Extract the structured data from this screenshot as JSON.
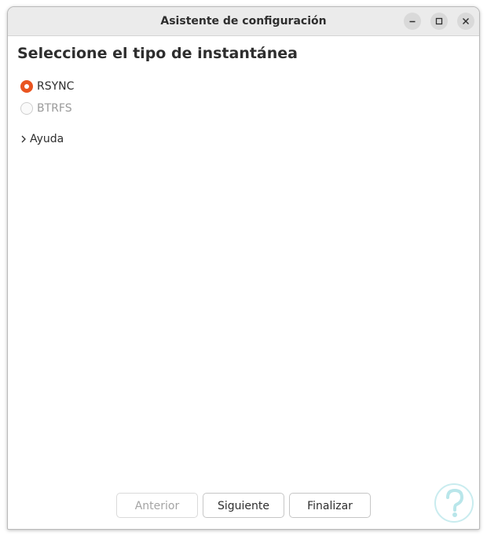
{
  "window": {
    "title": "Asistente de configuración",
    "controls": [
      "minimize-icon",
      "maximize-icon",
      "close-icon"
    ]
  },
  "page": {
    "heading": "Seleccione el tipo de instantánea"
  },
  "options": [
    {
      "label": "RSYNC",
      "selected": true,
      "enabled": true
    },
    {
      "label": "BTRFS",
      "selected": false,
      "enabled": false
    }
  ],
  "help": {
    "label": "Ayuda",
    "icon": "chevron-right-icon"
  },
  "buttons": {
    "previous": {
      "label": "Anterior",
      "enabled": false
    },
    "next": {
      "label": "Siguiente",
      "enabled": true
    },
    "finish": {
      "label": "Finalizar",
      "enabled": true
    }
  },
  "colors": {
    "accent": "#e95420",
    "titlebar": "#ebebeb",
    "watermark": "#b9e6ea"
  }
}
